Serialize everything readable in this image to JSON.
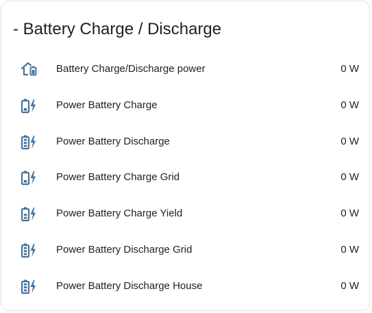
{
  "card": {
    "title": "- Battery Charge / Discharge",
    "icon_color": "#44739e",
    "rows": [
      {
        "label": "Battery Charge/Discharge power",
        "value": "0 W",
        "icon": "home-battery-icon"
      },
      {
        "label": "Power Battery Charge",
        "value": "0 W",
        "icon": "battery-charging-icon"
      },
      {
        "label": "Power Battery Discharge",
        "value": "0 W",
        "icon": "battery-discharging-icon"
      },
      {
        "label": "Power Battery Charge Grid",
        "value": "0 W",
        "icon": "battery-charging-icon"
      },
      {
        "label": "Power Battery Charge Yield",
        "value": "0 W",
        "icon": "battery-charging-medium-icon"
      },
      {
        "label": "Power Battery Discharge Grid",
        "value": "0 W",
        "icon": "battery-discharging-icon"
      },
      {
        "label": "Power Battery Discharge House",
        "value": "0 W",
        "icon": "battery-discharging-icon"
      }
    ]
  }
}
